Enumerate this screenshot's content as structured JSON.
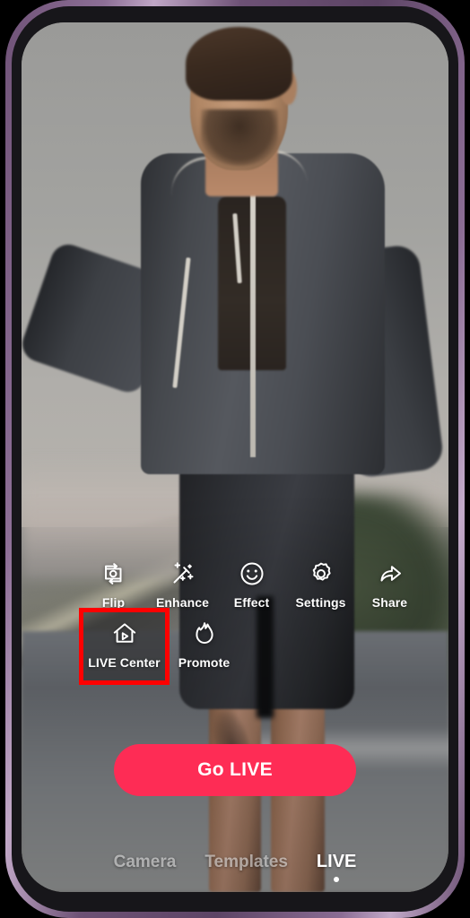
{
  "app": {
    "screen_name": "LIVE go-live preview",
    "accent_color": "#fe2c55",
    "highlight_color": "#ff0000"
  },
  "toolbar": {
    "row1": [
      {
        "label": "Flip",
        "icon": "camera-flip-icon"
      },
      {
        "label": "Enhance",
        "icon": "magic-wand-sparkle-icon"
      },
      {
        "label": "Effect",
        "icon": "smiley-face-icon"
      },
      {
        "label": "Settings",
        "icon": "gear-icon"
      },
      {
        "label": "Share",
        "icon": "share-arrow-icon"
      }
    ],
    "row2": [
      {
        "label": "LIVE Center",
        "icon": "house-play-icon",
        "highlighted": true
      },
      {
        "label": "Promote",
        "icon": "flame-icon"
      }
    ]
  },
  "primary_action": {
    "label": "Go LIVE"
  },
  "bottom_nav": {
    "items": [
      {
        "label": "Camera",
        "active": false
      },
      {
        "label": "Templates",
        "active": false
      },
      {
        "label": "LIVE",
        "active": true
      }
    ]
  }
}
